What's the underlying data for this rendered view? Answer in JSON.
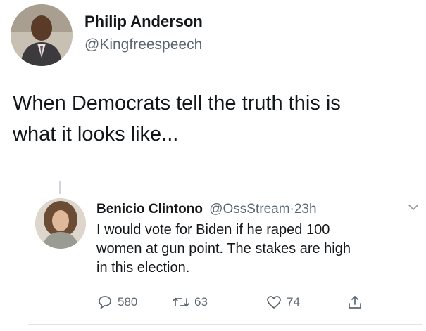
{
  "tweet": {
    "author": {
      "name": "Philip Anderson",
      "handle": "@Kingfreespeech",
      "avatar_icon": "profile-photo"
    },
    "text_lines": [
      "When Democrats tell the truth this is",
      "what it looks like..."
    ]
  },
  "reply": {
    "author": {
      "name": "Benicio Clintono",
      "handle": "@OssStream",
      "separator": "·",
      "time": "23h",
      "avatar_icon": "profile-photo"
    },
    "text_lines": [
      "I would vote for Biden if he raped 100",
      "women at gun point. The stakes are high",
      "in this election."
    ],
    "actions": {
      "reply_count": "580",
      "retweet_count": "63",
      "like_count": "74"
    }
  },
  "colors": {
    "text_primary": "#14171a",
    "text_secondary": "#5b6770",
    "divider": "#dfe3e6"
  }
}
